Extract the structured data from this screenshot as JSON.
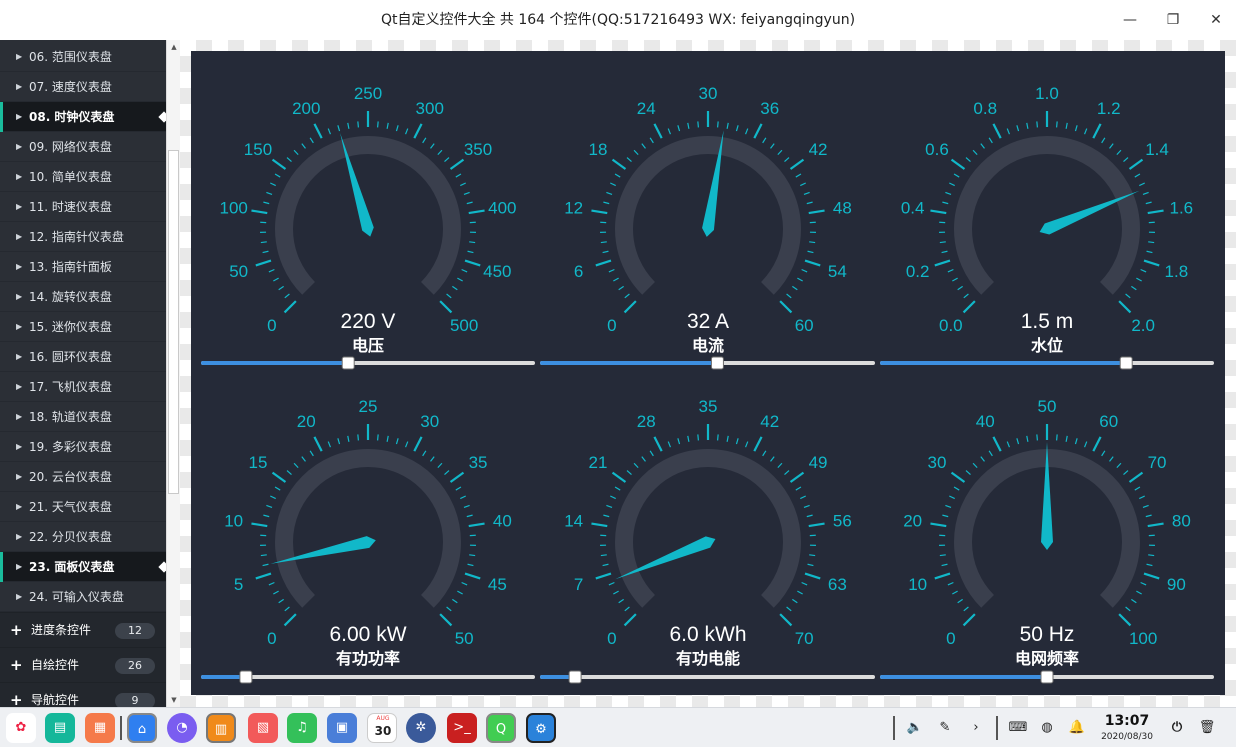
{
  "window": {
    "title": "Qt自定义控件大全 共 164 个控件(QQ:517216493 WX: feiyangqingyun)",
    "minimize_glyph": "—",
    "maximize_glyph": "❐",
    "close_glyph": "✕"
  },
  "sidebar": {
    "items": [
      {
        "label": "06. 范围仪表盘",
        "selected": false
      },
      {
        "label": "07. 速度仪表盘",
        "selected": false
      },
      {
        "label": "08. 时钟仪表盘",
        "selected": true
      },
      {
        "label": "09. 网络仪表盘",
        "selected": false
      },
      {
        "label": "10. 简单仪表盘",
        "selected": false
      },
      {
        "label": "11. 时速仪表盘",
        "selected": false
      },
      {
        "label": "12. 指南针仪表盘",
        "selected": false
      },
      {
        "label": "13. 指南针面板",
        "selected": false
      },
      {
        "label": "14. 旋转仪表盘",
        "selected": false
      },
      {
        "label": "15. 迷你仪表盘",
        "selected": false
      },
      {
        "label": "16. 圆环仪表盘",
        "selected": false
      },
      {
        "label": "17. 飞机仪表盘",
        "selected": false
      },
      {
        "label": "18. 轨道仪表盘",
        "selected": false
      },
      {
        "label": "19. 多彩仪表盘",
        "selected": false
      },
      {
        "label": "20. 云台仪表盘",
        "selected": false
      },
      {
        "label": "21. 天气仪表盘",
        "selected": false
      },
      {
        "label": "22. 分贝仪表盘",
        "selected": false
      },
      {
        "label": "23. 面板仪表盘",
        "selected": true
      },
      {
        "label": "24. 可输入仪表盘",
        "selected": false
      }
    ],
    "groups": [
      {
        "label": "进度条控件",
        "count": "12"
      },
      {
        "label": "自绘控件",
        "count": "26"
      },
      {
        "label": "导航控件",
        "count": "9"
      }
    ]
  },
  "gauges": [
    {
      "value_text": "220 V",
      "name": "电压",
      "min": 0,
      "max": 500,
      "value": 220,
      "ticks": [
        "0",
        "50",
        "100",
        "150",
        "200",
        "250",
        "300",
        "350",
        "400",
        "450",
        "500"
      ],
      "slider": 0.44
    },
    {
      "value_text": "32 A",
      "name": "电流",
      "min": 0,
      "max": 60,
      "value": 32,
      "ticks": [
        "0",
        "6",
        "12",
        "18",
        "24",
        "30",
        "36",
        "42",
        "48",
        "54",
        "60"
      ],
      "slider": 0.53
    },
    {
      "value_text": "1.5 m",
      "name": "水位",
      "min": 0,
      "max": 2,
      "value": 1.5,
      "ticks": [
        "0.0",
        "0.2",
        "0.4",
        "0.6",
        "0.8",
        "1.0",
        "1.2",
        "1.4",
        "1.6",
        "1.8",
        "2.0"
      ],
      "slider": 0.74
    },
    {
      "value_text": "6.00 kW",
      "name": "有功功率",
      "min": 0,
      "max": 50,
      "value": 6,
      "ticks": [
        "0",
        "5",
        "10",
        "15",
        "20",
        "25",
        "30",
        "35",
        "40",
        "45",
        "50"
      ],
      "slider": 0.13
    },
    {
      "value_text": "6.0 kWh",
      "name": "有功电能",
      "min": 0,
      "max": 70,
      "value": 6,
      "ticks": [
        "0",
        "7",
        "14",
        "21",
        "28",
        "35",
        "42",
        "49",
        "56",
        "63",
        "70"
      ],
      "slider": 0.1
    },
    {
      "value_text": "50 Hz",
      "name": "电网频率",
      "min": 0,
      "max": 100,
      "value": 50,
      "ticks": [
        "0",
        "10",
        "20",
        "30",
        "40",
        "50",
        "60",
        "70",
        "80",
        "90",
        "100"
      ],
      "slider": 0.5
    }
  ],
  "colors": {
    "panel_bg": "#252a38",
    "accent": "#11b8c9",
    "arc": "#3a3f4d",
    "slider_fill": "#3d8fe0",
    "slider_track": "#dcdcdc"
  },
  "taskbar": {
    "calendar_month": "AUG",
    "calendar_day": "30",
    "time": "13:07",
    "date": "2020/08/30"
  }
}
